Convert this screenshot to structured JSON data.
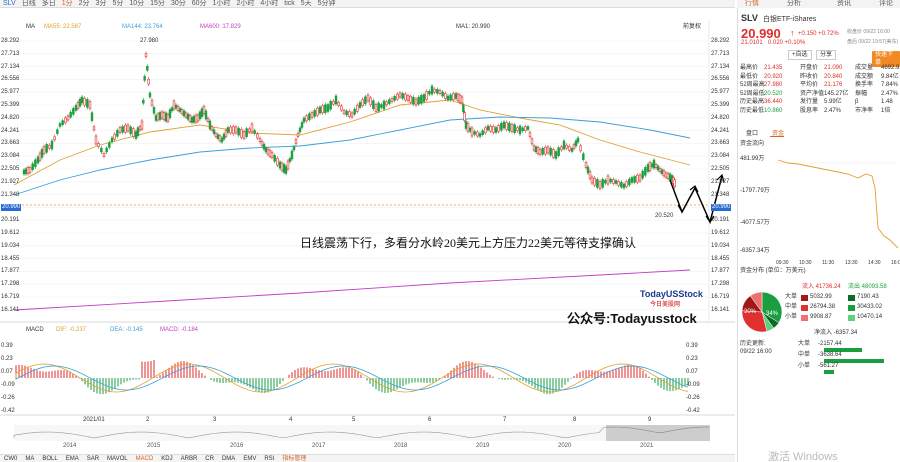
{
  "toolbar": {
    "items": [
      "SLV",
      "日线",
      "多日",
      "1分",
      "2分",
      "3分",
      "5分",
      "10分",
      "15分",
      "30分",
      "60分",
      "1小时",
      "2小时",
      "4小时",
      "tick",
      "5天",
      "5分钟"
    ]
  },
  "right_tabs": {
    "t1": "行情",
    "t2": "分析",
    "t3": "资讯",
    "t4": "评论"
  },
  "main_legend": {
    "ma": "MA",
    "ma5": "MA55: 22.587",
    "ma144": "MA144: 23.764",
    "ma600": "MA600: 17.829",
    "ma1": "MA1: 20.990",
    "right": "前复权"
  },
  "y_axis_right": [
    "28.292",
    "27.713",
    "27.134",
    "26.556",
    "25.977",
    "25.399",
    "24.820",
    "24.241",
    "23.663",
    "23.084",
    "22.505",
    "21.927",
    "21.348",
    "20.990",
    "20.191",
    "19.612",
    "19.034",
    "18.455",
    "17.877",
    "17.298",
    "16.719",
    "16.141"
  ],
  "y_axis_left": [
    "28.292",
    "27.713",
    "27.134",
    "26.556",
    "25.977",
    "25.399",
    "24.820",
    "24.241",
    "23.663",
    "23.084",
    "22.505",
    "21.927",
    "21.348",
    "20.990",
    "20.191",
    "19.612",
    "19.034",
    "18.455",
    "17.877",
    "17.298",
    "16.719",
    "16.141"
  ],
  "peak_label": "27.980",
  "low_label": "20.520",
  "annotation": "日线震荡下行，多看分水岭20美元上方压力22美元等待支撑确认",
  "watermark": {
    "brand": "TodayUSStock",
    "brand_sub": "今日美股网",
    "wechat": "公众号:Todayusstock"
  },
  "macd_legend": {
    "name": "MACD",
    "dif": "DIF: -0.237",
    "dea": "DEA: -0.145",
    "macd": "MACD: -0.184"
  },
  "macd_axis": [
    "0.39",
    "0.23",
    "0.07",
    "-0.09",
    "-0.26",
    "-0.42"
  ],
  "months": [
    "2021/01",
    "2",
    "3",
    "4",
    "5",
    "6",
    "7",
    "8",
    "9"
  ],
  "years": [
    "2014",
    "2015",
    "2016",
    "2017",
    "2018",
    "2019",
    "2020",
    "2021"
  ],
  "bottom_tabs": [
    "CW0",
    "MA",
    "BOLL",
    "EMA",
    "SAR",
    "MAVOL",
    "MACD",
    "KDJ",
    "ARBR",
    "CR",
    "DMA",
    "EMV",
    "RSI",
    "指标管理"
  ],
  "panel": {
    "symbol": "SLV",
    "name": "白银ETF-iShares",
    "price": "20.990",
    "change": "+0.150 +0.72%",
    "close_label": "收盘价 09/22 16:00",
    "ah_price": "21.0101",
    "ah_change": "0.020 +0.10%",
    "ah_label": "盘后 09/22 19:57(美东)",
    "btn_add": "+自选",
    "btn_share": "分享",
    "btn_trade": "快速下单",
    "stats": [
      [
        "最高价",
        "21.435",
        "开盘价",
        "21.090",
        "成交量",
        "4692.91万"
      ],
      [
        "最低价",
        "20.920",
        "昨收价",
        "20.840",
        "成交额",
        "9.84亿"
      ],
      [
        "52周最高",
        "27.980",
        "平均价",
        "21.176",
        "换手率",
        "7.84%"
      ],
      [
        "52周最低",
        "20.520",
        "资产净值",
        "145.27亿",
        "振幅",
        "2.47%"
      ],
      [
        "历史最高",
        "36.440",
        "发行量",
        "5.99亿",
        "β",
        "1.48"
      ],
      [
        "历史最低",
        "10.860",
        "股息率",
        "2.47%",
        "市净率",
        "1倍"
      ]
    ],
    "tab_pankou": "盘口",
    "tab_zijin": "资金",
    "flow_title": "资金流向",
    "flow_axis": [
      "481.99万",
      "-1797.79万",
      "-4077.57万",
      "-6357.34万"
    ],
    "flow_time": [
      "09:30",
      "10:30",
      "11:30",
      "13:30",
      "14:30",
      "16:00"
    ],
    "dist_title": "资金分布 (单位：万美元)",
    "inflow": "流入 41736.24",
    "outflow": "流出 48093.58",
    "rows": [
      [
        "大单",
        "5032.99",
        "7190.43"
      ],
      [
        "中单",
        "26794.38",
        "30433.02"
      ],
      [
        "小单",
        "9908.87",
        "10470.14"
      ]
    ],
    "pie": {
      "red_big": "30%",
      "green": "34%"
    },
    "net_title": "净流入 -6357.34",
    "hist_title": "历史更新:",
    "hist_time": "09/22 16:00",
    "net_rows": [
      [
        "大单",
        "-2157.44"
      ],
      [
        "中单",
        "-3638.64"
      ],
      [
        "小单",
        "-561.27"
      ]
    ]
  },
  "windows_wm": "激活 Windows"
}
